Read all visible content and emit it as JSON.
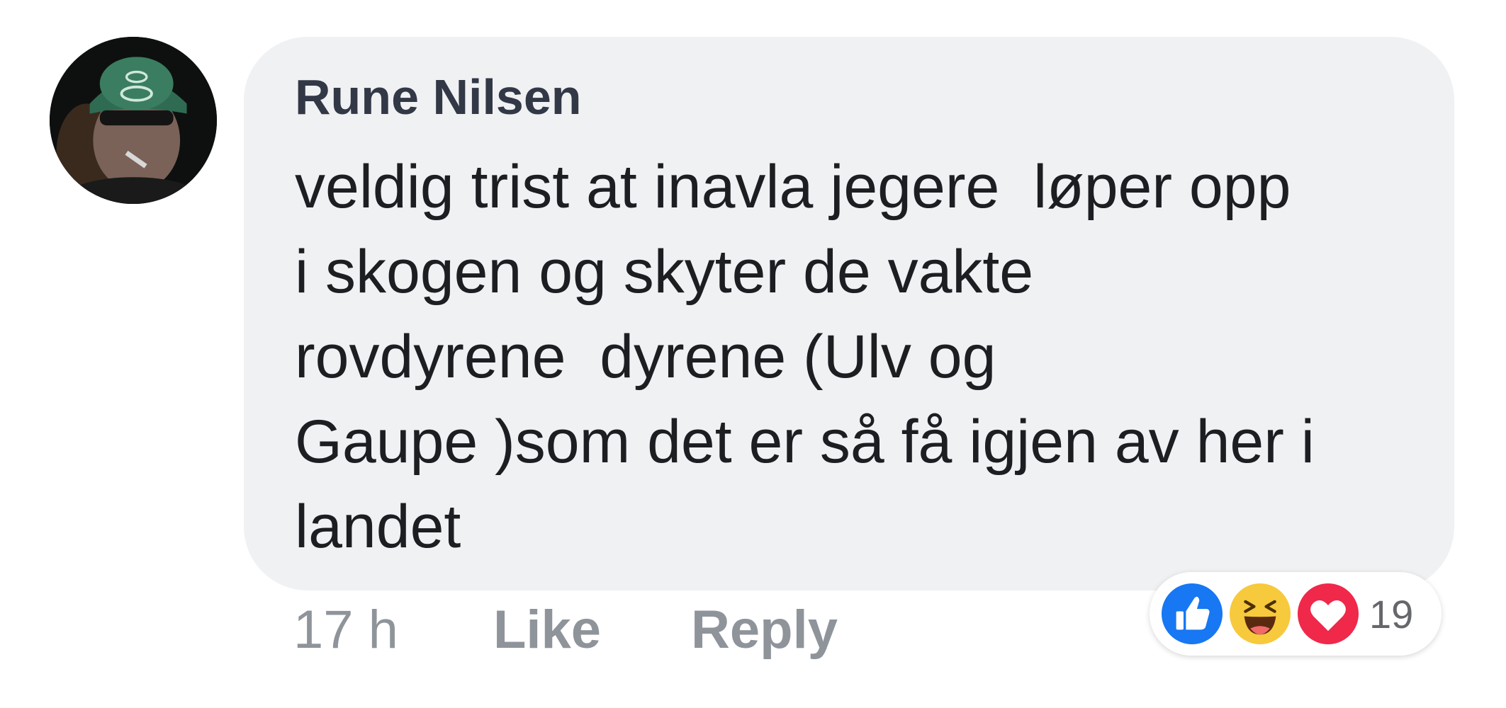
{
  "comment": {
    "author": "Rune Nilsen",
    "text_lines": [
      "veldig trist at inavla jegere  løper opp",
      "i skogen og skyter de vakte",
      "rovdyrene  dyrene (Ulv og",
      "Gaupe )som det er så få igjen av her i",
      "landet"
    ],
    "timestamp": "17 h",
    "like_label": "Like",
    "reply_label": "Reply",
    "reactions": {
      "icons": [
        "like-icon",
        "haha-icon",
        "love-icon"
      ],
      "count": "19"
    }
  },
  "colors": {
    "bubble_bg": "#f0f1f3",
    "author": "#323846",
    "meta": "#8f949b",
    "like_blue": "#1877f2",
    "haha_yellow": "#f7c93c",
    "love_red": "#f0284a"
  }
}
